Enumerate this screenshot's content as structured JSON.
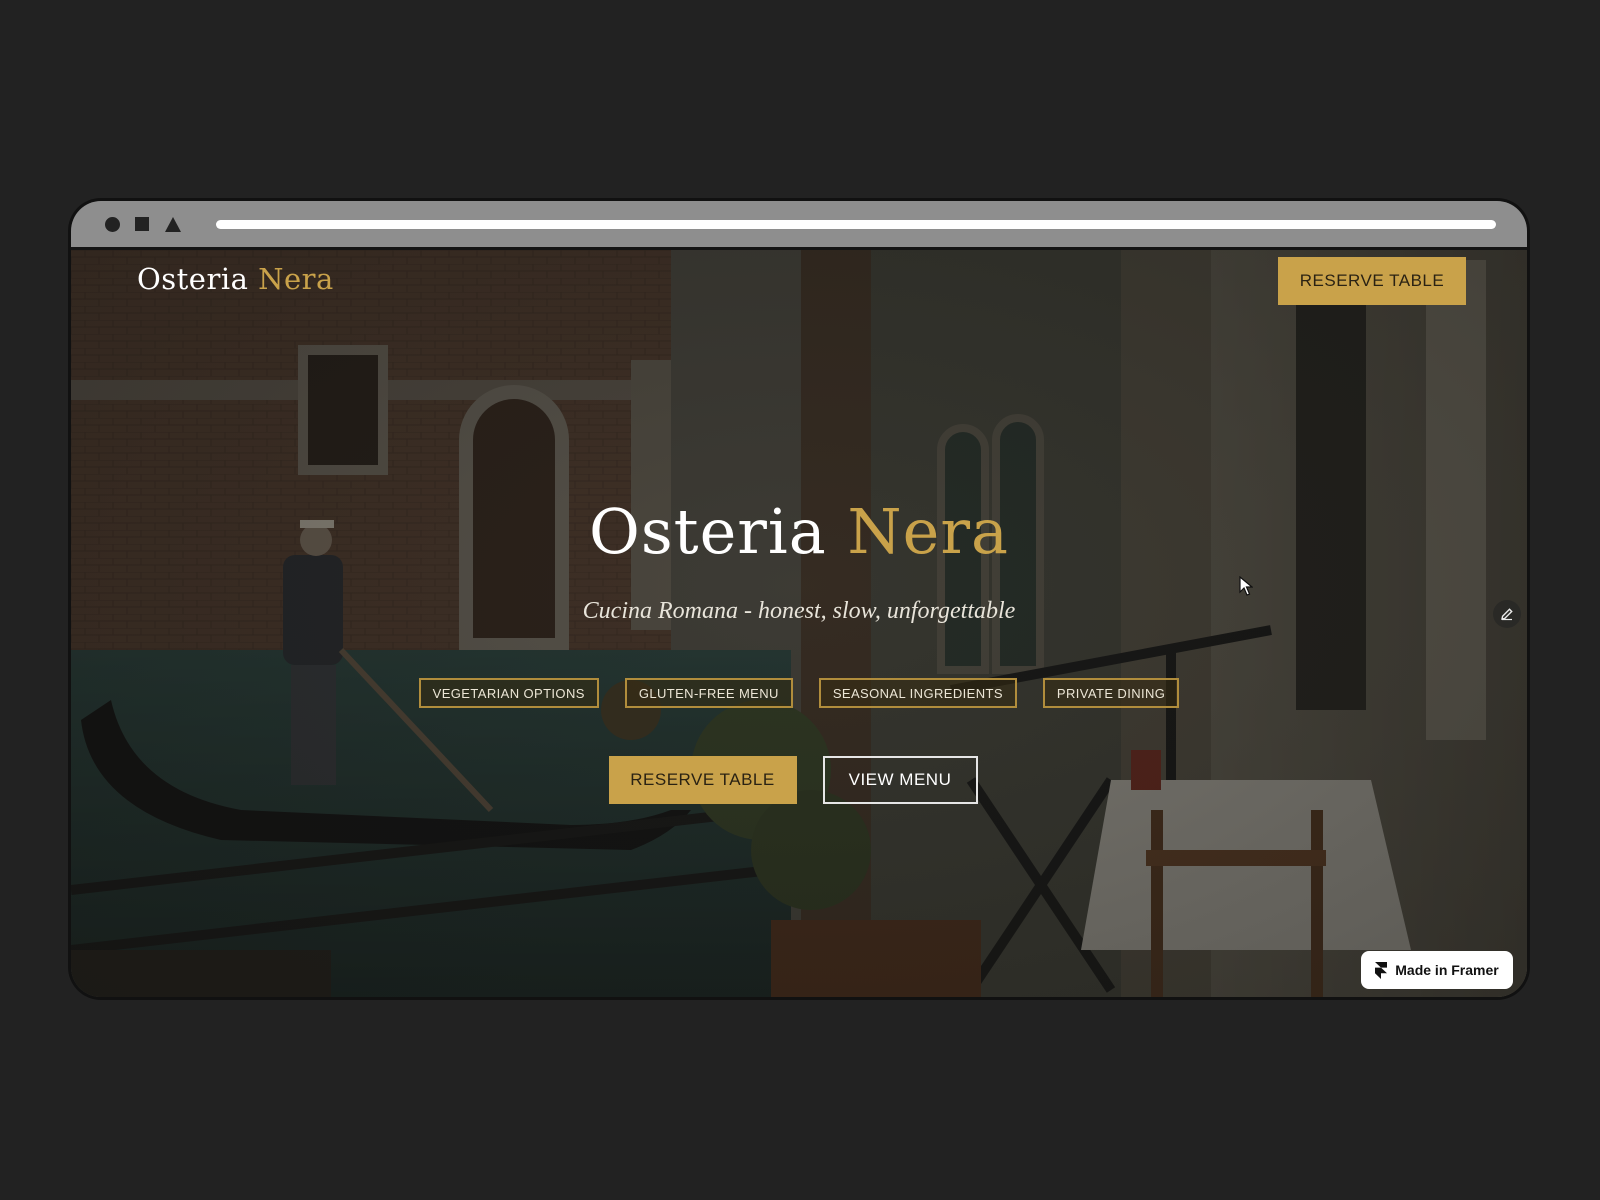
{
  "browser_chrome": {
    "controls": [
      "circle-icon",
      "square-icon",
      "triangle-icon"
    ]
  },
  "nav": {
    "logo_primary": "Osteria",
    "logo_accent": "Nera",
    "cta_label": "RESERVE TABLE"
  },
  "hero": {
    "title_primary": "Osteria",
    "title_accent": "Nera",
    "subtitle": "Cucina Romana - honest, slow, unforgettable",
    "tags": [
      "VEGETARIAN OPTIONS",
      "GLUTEN-FREE MENU",
      "SEASONAL INGREDIENTS",
      "PRIVATE DINING"
    ],
    "primary_cta": "RESERVE TABLE",
    "secondary_cta": "VIEW MENU"
  },
  "badge": {
    "label": "Made in Framer",
    "icon": "framer-logo-icon"
  },
  "colors": {
    "background": "#222222",
    "accent_gold": "#c9a24a",
    "text_light": "#ffffff"
  }
}
